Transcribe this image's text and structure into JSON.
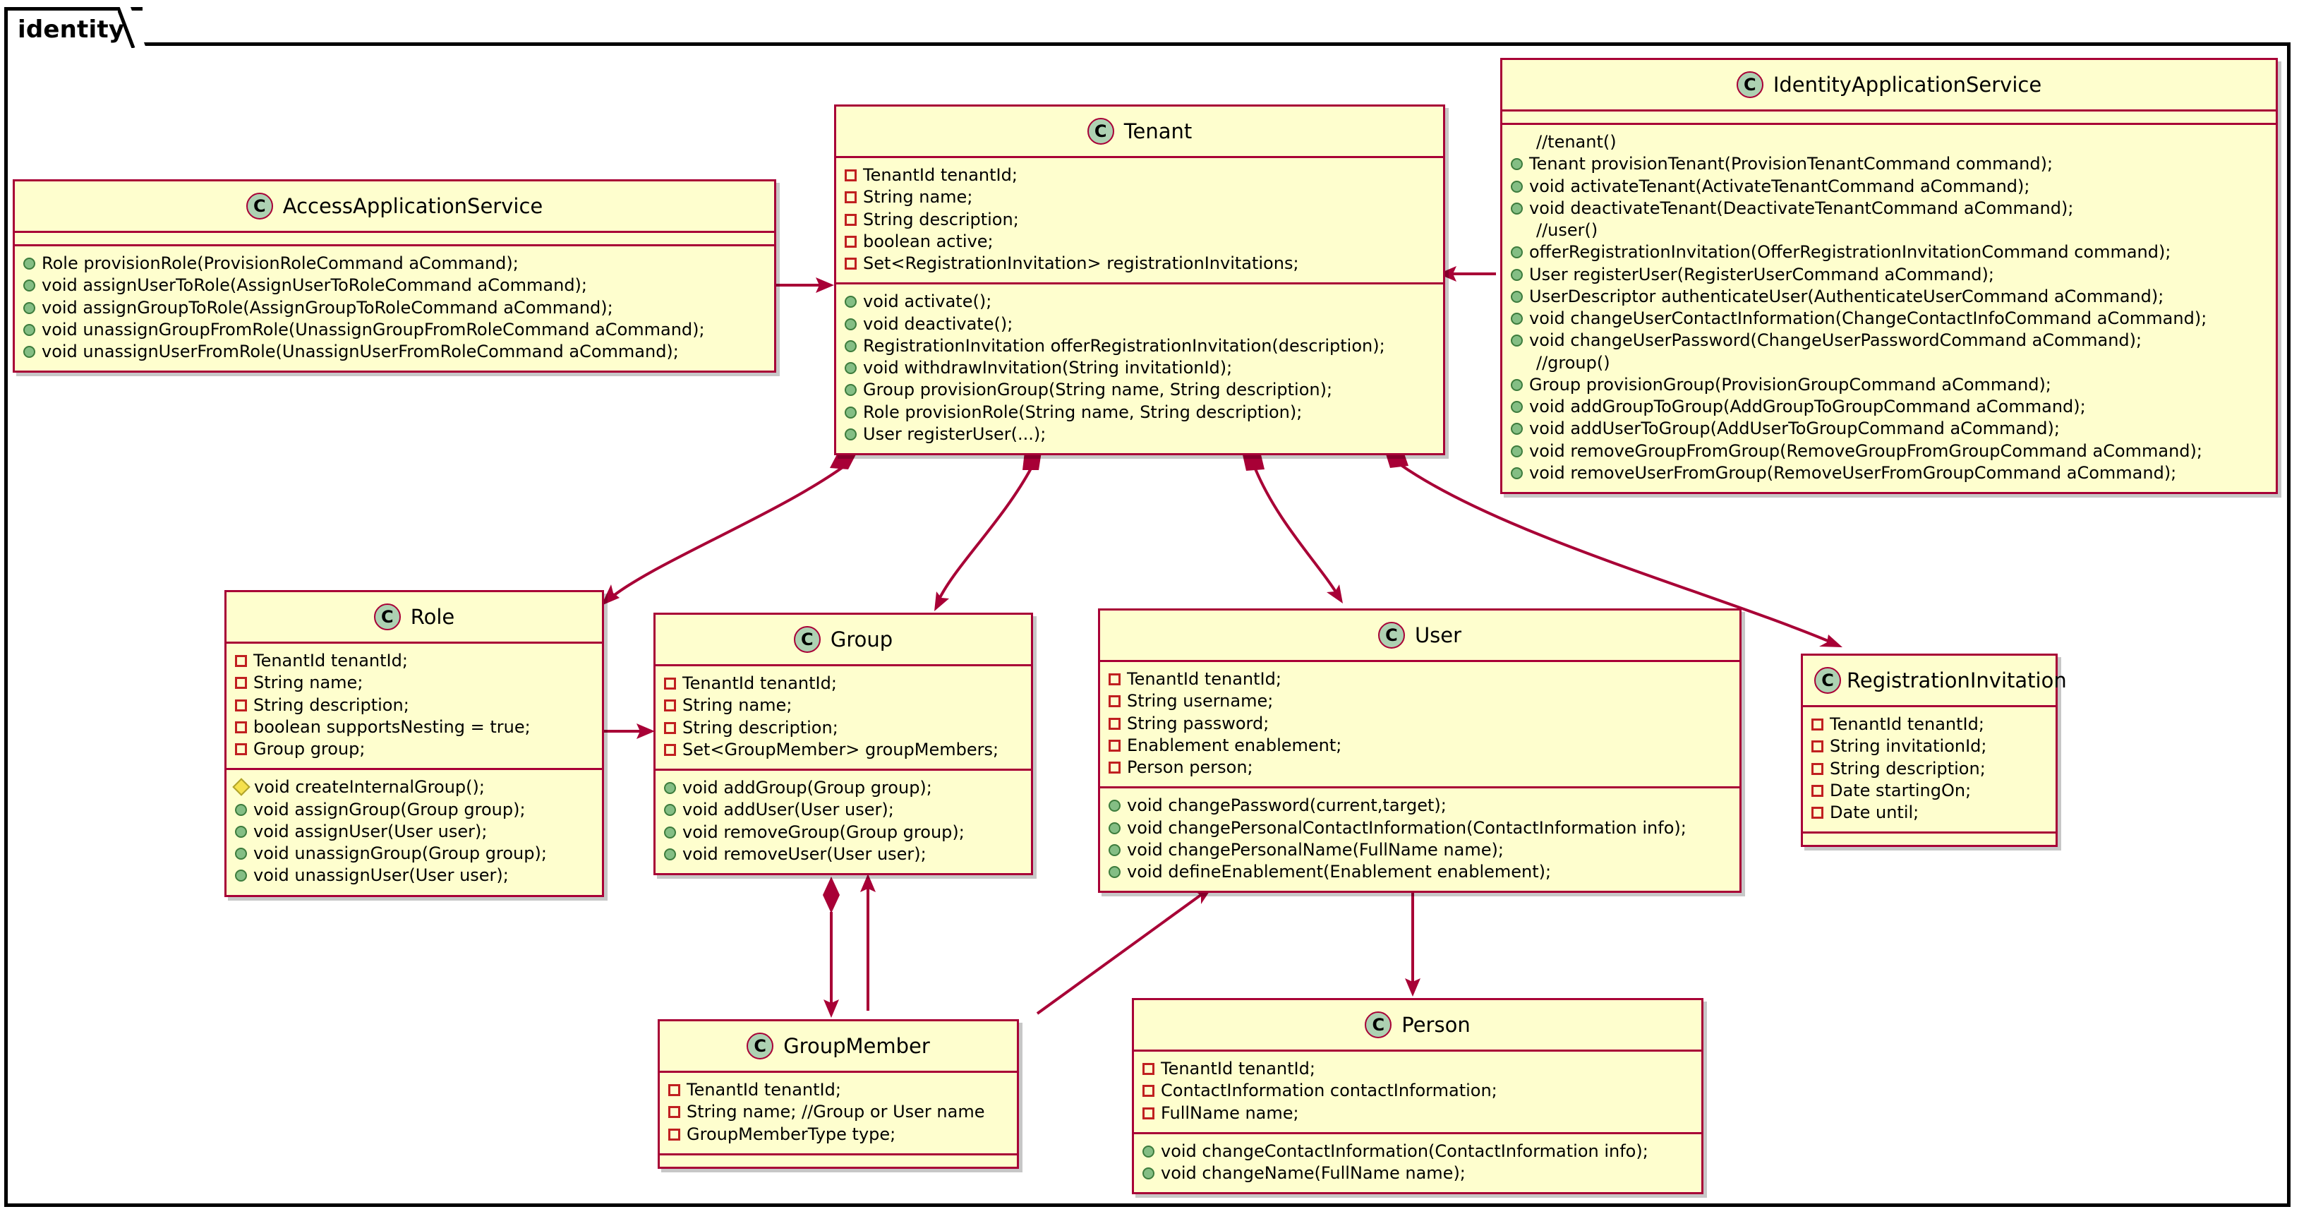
{
  "package": {
    "name": "identity"
  },
  "icons": {
    "class_icon": "class-icon",
    "field_icon": "private-field-icon",
    "method_icon": "public-method-icon",
    "package_method_icon": "package-private-method-icon"
  },
  "colors": {
    "box_fill": "#FEFECE",
    "box_border": "#A80036",
    "icon_fill": "#ADD1B2",
    "method_marker": "#84BE84",
    "field_marker": "#C02020",
    "package_marker": "#F5E14C",
    "frame": "#000000"
  },
  "classes": {
    "access_application_service": {
      "name": "AccessApplicationService",
      "fields": [],
      "methods": [
        "Role provisionRole(ProvisionRoleCommand aCommand);",
        "void assignUserToRole(AssignUserToRoleCommand aCommand);",
        "void assignGroupToRole(AssignGroupToRoleCommand aCommand);",
        "void unassignGroupFromRole(UnassignGroupFromRoleCommand aCommand);",
        "void unassignUserFromRole(UnassignUserFromRoleCommand aCommand);"
      ]
    },
    "tenant": {
      "name": "Tenant",
      "fields": [
        "TenantId tenantId;",
        "String name;",
        "String description;",
        "boolean active;",
        "Set<RegistrationInvitation> registrationInvitations;"
      ],
      "methods": [
        "void activate();",
        "void deactivate();",
        "RegistrationInvitation offerRegistrationInvitation(description);",
        "void withdrawInvitation(String invitationId);",
        "Group provisionGroup(String name, String description);",
        "Role provisionRole(String name, String description);",
        "User registerUser(...);"
      ]
    },
    "identity_application_service": {
      "name": "IdentityApplicationService",
      "fields": [],
      "methods": [
        {
          "text": "//tenant()",
          "kind": "comment"
        },
        {
          "text": "Tenant provisionTenant(ProvisionTenantCommand command);",
          "kind": "method"
        },
        {
          "text": "void activateTenant(ActivateTenantCommand aCommand);",
          "kind": "method"
        },
        {
          "text": "void deactivateTenant(DeactivateTenantCommand aCommand);",
          "kind": "method"
        },
        {
          "text": "//user()",
          "kind": "comment"
        },
        {
          "text": "offerRegistrationInvitation(OfferRegistrationInvitationCommand command);",
          "kind": "method"
        },
        {
          "text": "User registerUser(RegisterUserCommand aCommand);",
          "kind": "method"
        },
        {
          "text": "UserDescriptor authenticateUser(AuthenticateUserCommand aCommand);",
          "kind": "method"
        },
        {
          "text": "void changeUserContactInformation(ChangeContactInfoCommand aCommand);",
          "kind": "method"
        },
        {
          "text": "void changeUserPassword(ChangeUserPasswordCommand aCommand);",
          "kind": "method"
        },
        {
          "text": "//group()",
          "kind": "comment"
        },
        {
          "text": "Group provisionGroup(ProvisionGroupCommand aCommand);",
          "kind": "method"
        },
        {
          "text": "void addGroupToGroup(AddGroupToGroupCommand aCommand);",
          "kind": "method"
        },
        {
          "text": "void addUserToGroup(AddUserToGroupCommand aCommand);",
          "kind": "method"
        },
        {
          "text": "void removeGroupFromGroup(RemoveGroupFromGroupCommand aCommand);",
          "kind": "method"
        },
        {
          "text": "void removeUserFromGroup(RemoveUserFromGroupCommand aCommand);",
          "kind": "method"
        }
      ]
    },
    "role": {
      "name": "Role",
      "fields": [
        "TenantId tenantId;",
        "String name;",
        "String description;",
        "boolean supportsNesting = true;",
        "Group group;"
      ],
      "methods": [
        {
          "text": "void createInternalGroup();",
          "kind": "package"
        },
        {
          "text": "void assignGroup(Group group);",
          "kind": "method"
        },
        {
          "text": "void assignUser(User user);",
          "kind": "method"
        },
        {
          "text": "void unassignGroup(Group group);",
          "kind": "method"
        },
        {
          "text": "void unassignUser(User user);",
          "kind": "method"
        }
      ]
    },
    "group": {
      "name": "Group",
      "fields": [
        "TenantId tenantId;",
        "String name;",
        "String description;",
        "Set<GroupMember> groupMembers;"
      ],
      "methods": [
        "void addGroup(Group group);",
        "void addUser(User user);",
        "void removeGroup(Group group);",
        "void removeUser(User user);"
      ]
    },
    "user": {
      "name": "User",
      "fields": [
        "TenantId tenantId;",
        "String username;",
        "String password;",
        "Enablement enablement;",
        "Person person;"
      ],
      "methods": [
        "void changePassword(current,target);",
        "void changePersonalContactInformation(ContactInformation info);",
        "void changePersonalName(FullName name);",
        "void defineEnablement(Enablement enablement);"
      ]
    },
    "registration_invitation": {
      "name": "RegistrationInvitation",
      "fields": [
        "TenantId tenantId;",
        "String invitationId;",
        "String description;",
        "Date startingOn;",
        "Date until;"
      ],
      "methods": []
    },
    "group_member": {
      "name": "GroupMember",
      "fields": [
        "TenantId tenantId;",
        "String name; //Group or User name",
        "GroupMemberType type;"
      ],
      "methods": []
    },
    "person": {
      "name": "Person",
      "fields": [
        "TenantId tenantId;",
        "ContactInformation contactInformation;",
        "FullName name;"
      ],
      "methods": [
        "void changeContactInformation(ContactInformation info);",
        "void changeName(FullName name);"
      ]
    }
  },
  "relationships": [
    {
      "from": "AccessApplicationService",
      "to": "Tenant",
      "type": "association"
    },
    {
      "from": "IdentityApplicationService",
      "to": "Tenant",
      "type": "association"
    },
    {
      "from": "Tenant",
      "to": "Role",
      "type": "composition"
    },
    {
      "from": "Tenant",
      "to": "Group",
      "type": "composition"
    },
    {
      "from": "Tenant",
      "to": "User",
      "type": "composition"
    },
    {
      "from": "Tenant",
      "to": "RegistrationInvitation",
      "type": "composition"
    },
    {
      "from": "Role",
      "to": "Group",
      "type": "association"
    },
    {
      "from": "Group",
      "to": "GroupMember",
      "type": "composition"
    },
    {
      "from": "GroupMember",
      "to": "Group",
      "type": "association"
    },
    {
      "from": "GroupMember",
      "to": "User",
      "type": "association"
    },
    {
      "from": "User",
      "to": "Person",
      "type": "association"
    }
  ]
}
